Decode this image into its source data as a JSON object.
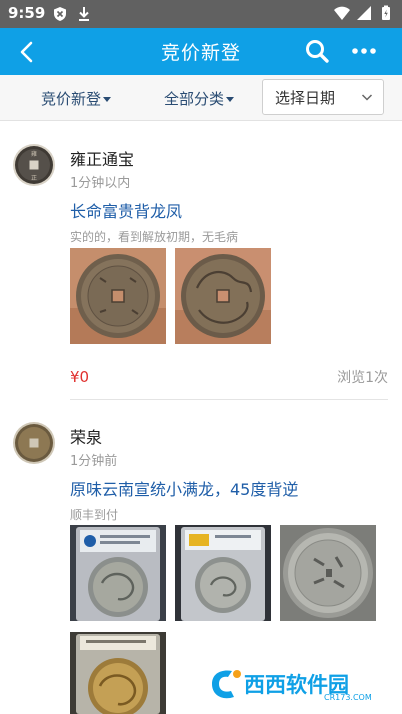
{
  "status_bar": {
    "time": "9:59",
    "icons": [
      "shield-notification-icon",
      "download-icon",
      "wifi-icon",
      "signal-icon",
      "battery-icon"
    ]
  },
  "app_bar": {
    "title": "竞价新登",
    "back_icon": "back-arrow-icon",
    "search_icon": "search-icon",
    "more_icon": "more-dots-icon",
    "color": "#0fa0e6"
  },
  "filters": {
    "sort_label": "竞价新登",
    "category_label": "全部分类",
    "date_placeholder": "选择日期"
  },
  "posts": [
    {
      "user": "雍正通宝",
      "time": "1分钟以内",
      "title": "长命富贵背龙凤",
      "desc": "实的的，看到解放初期，无毛病",
      "price": "¥0",
      "views": "浏览1次"
    },
    {
      "user": "荣泉",
      "time": "1分钟前",
      "title": "原味云南宣统小满龙，45度背逆",
      "desc": "顺丰到付"
    }
  ],
  "watermark": {
    "brand": "西西软件园",
    "url": "CR173.COM"
  },
  "colors": {
    "accent": "#0fa0e6",
    "link": "#1f5ea8",
    "price": "#e0302e"
  }
}
